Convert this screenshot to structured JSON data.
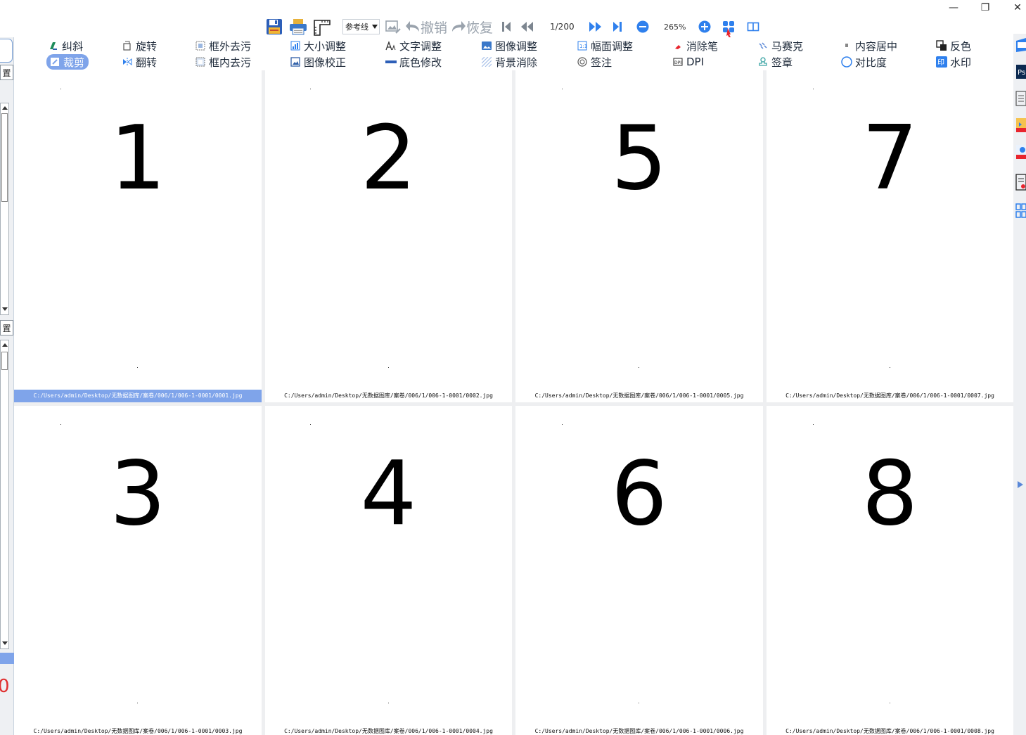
{
  "toolbar": {
    "ref_line": "参考线",
    "undo": "撤销",
    "redo": "恢复",
    "page_indicator": "1/200",
    "zoom": "265%"
  },
  "functions": {
    "row1": [
      "纠斜",
      "旋转",
      "框外去污",
      "大小调整",
      "文字调整",
      "图像调整",
      "幅面调整",
      "消除笔",
      "马赛克",
      "内容居中",
      "反色"
    ],
    "row2": [
      "裁剪",
      "翻转",
      "框内去污",
      "图像校正",
      "底色修改",
      "背景消除",
      "签注",
      "DPI",
      "签章",
      "对比度",
      "水印"
    ]
  },
  "left_dock": {
    "tab1": "置",
    "tab2": "置",
    "red_char": "0"
  },
  "pages": [
    {
      "number": "1",
      "path": "C:/Users/admin/Desktop/无数据图库/案卷/006/1/006-1-0001/0001.jpg"
    },
    {
      "number": "2",
      "path": "C:/Users/admin/Desktop/无数据图库/案卷/006/1/006-1-0001/0002.jpg"
    },
    {
      "number": "5",
      "path": "C:/Users/admin/Desktop/无数据图库/案卷/006/1/006-1-0001/0005.jpg"
    },
    {
      "number": "7",
      "path": "C:/Users/admin/Desktop/无数据图库/案卷/006/1/006-1-0001/0007.jpg"
    },
    {
      "number": "3",
      "path": "C:/Users/admin/Desktop/无数据图库/案卷/006/1/006-1-0001/0003.jpg"
    },
    {
      "number": "4",
      "path": "C:/Users/admin/Desktop/无数据图库/案卷/006/1/006-1-0001/0004.jpg"
    },
    {
      "number": "6",
      "path": "C:/Users/admin/Desktop/无数据图库/案卷/006/1/006-1-0001/0006.jpg"
    },
    {
      "number": "8",
      "path": "C:/Users/admin/Desktop/无数据图库/案卷/006/1/006-1-0001/0008.jpg"
    }
  ],
  "colors": {
    "accent_blue": "#2f80ed",
    "selected_bg": "#7fa4ea",
    "grid_bg": "#eeeff1"
  }
}
